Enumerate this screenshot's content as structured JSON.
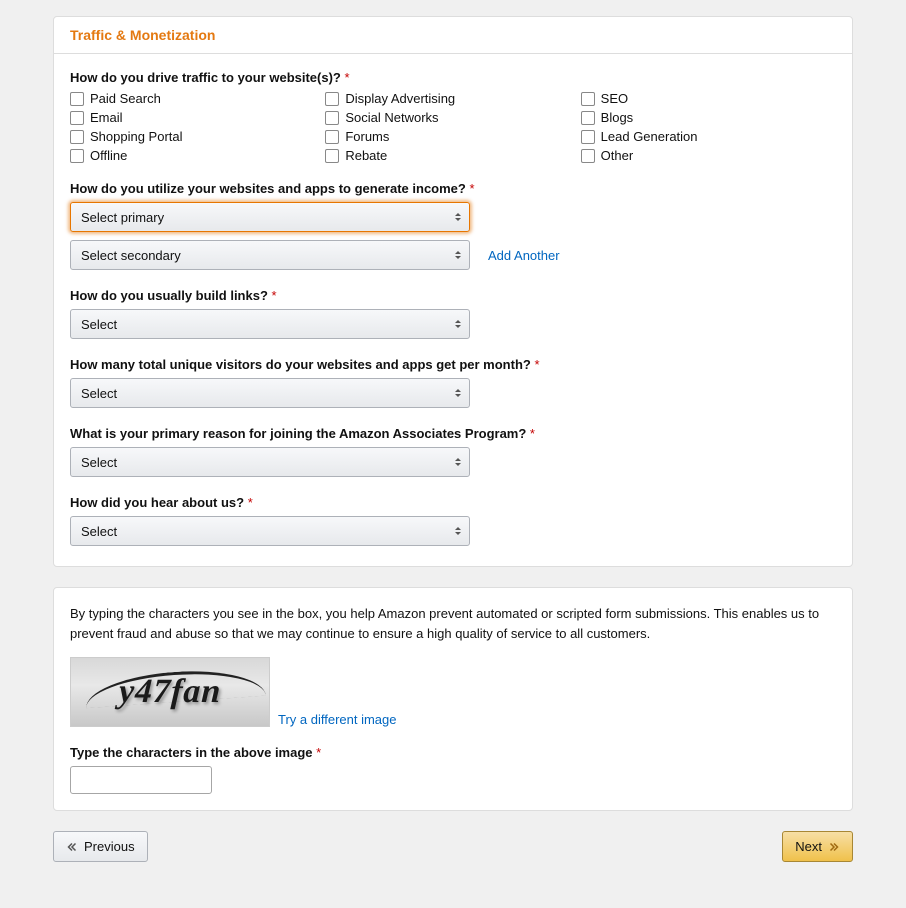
{
  "section": {
    "title": "Traffic & Monetization"
  },
  "questions": {
    "traffic": {
      "label": "How do you drive traffic to your website(s)?",
      "options": [
        "Paid Search",
        "Display Advertising",
        "SEO",
        "Email",
        "Social Networks",
        "Blogs",
        "Shopping Portal",
        "Forums",
        "Lead Generation",
        "Offline",
        "Rebate",
        "Other"
      ]
    },
    "income": {
      "label": "How do you utilize your websites and apps to generate income?",
      "primary": "Select primary",
      "secondary": "Select secondary",
      "addAnother": "Add Another"
    },
    "buildLinks": {
      "label": "How do you usually build links?",
      "value": "Select"
    },
    "visitors": {
      "label": "How many total unique visitors do your websites and apps get per month?",
      "value": "Select"
    },
    "reason": {
      "label": "What is your primary reason for joining the Amazon Associates Program?",
      "value": "Select"
    },
    "hear": {
      "label": "How did you hear about us?",
      "value": "Select"
    }
  },
  "captcha": {
    "intro": "By typing the characters you see in the box, you help Amazon prevent automated or scripted form submissions. This enables us to prevent fraud and abuse so that we may continue to ensure a high quality of service to all customers.",
    "text": "y47fan",
    "tryDifferent": "Try a different image",
    "inputLabel": "Type the characters in the above image"
  },
  "buttons": {
    "previous": "Previous",
    "next": "Next"
  }
}
